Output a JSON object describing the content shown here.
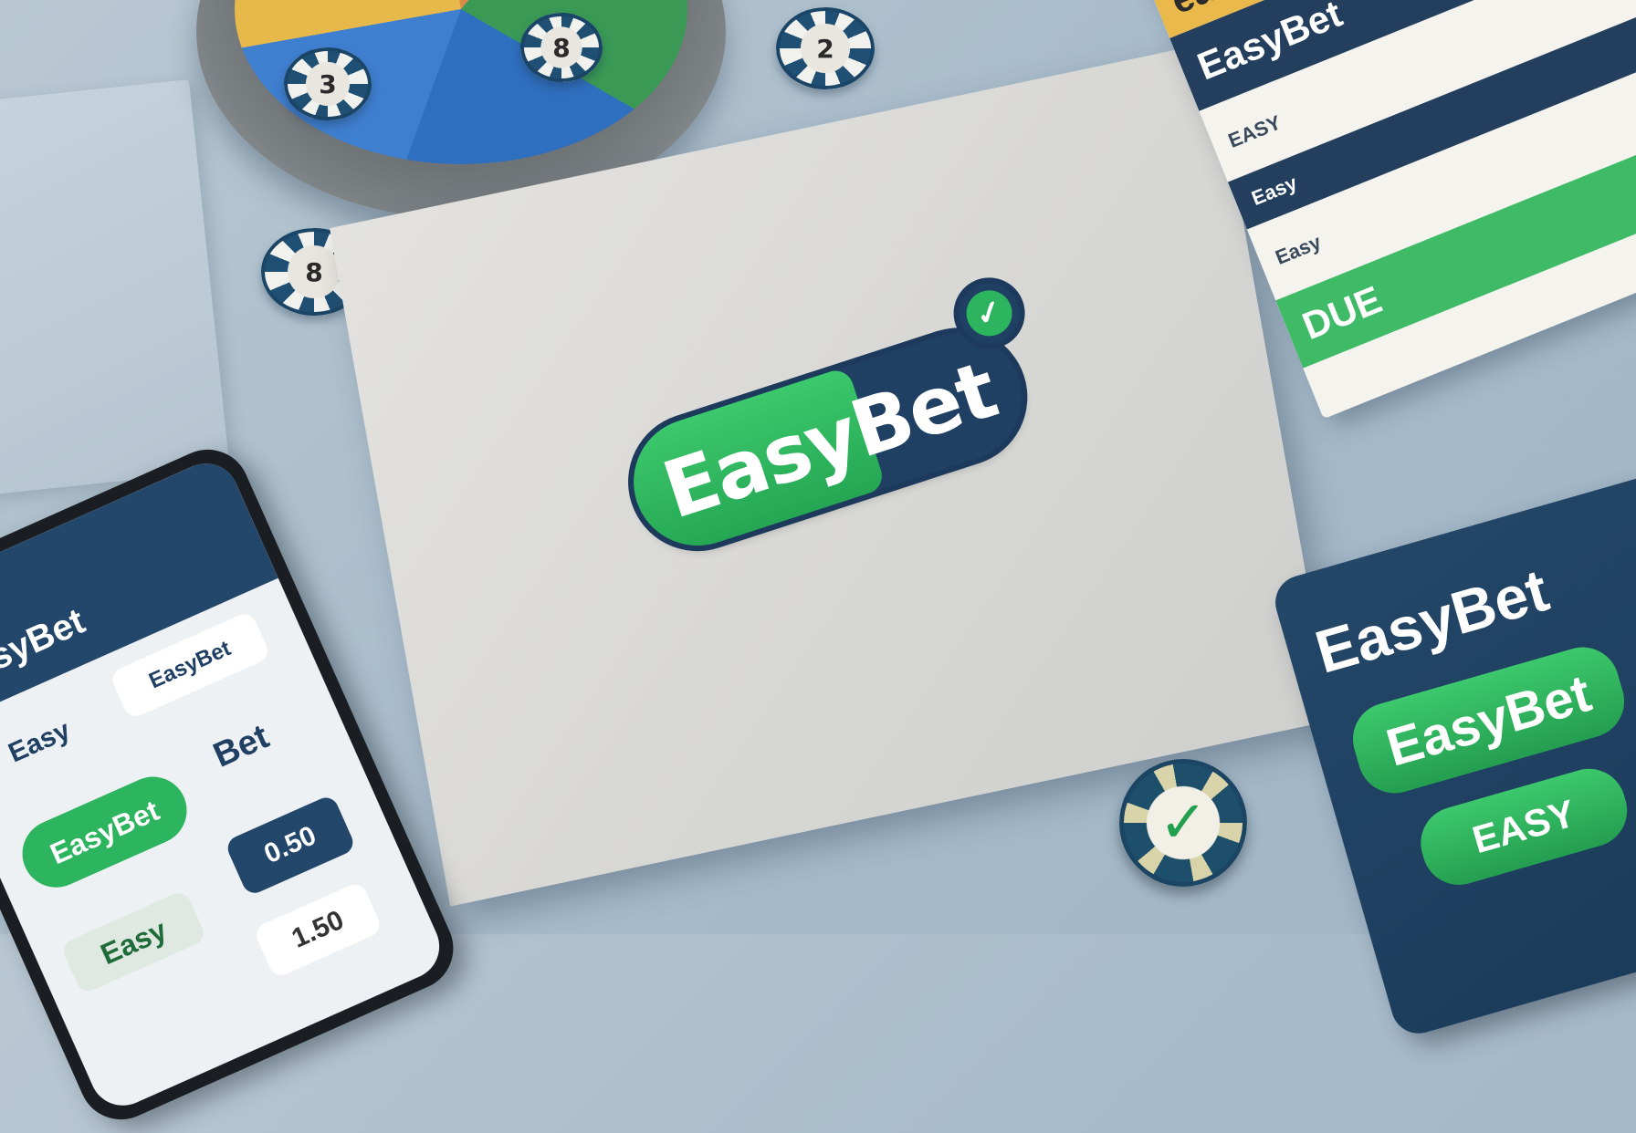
{
  "logo": {
    "text": "EasyBet",
    "accent_green": "#2db45f",
    "navy": "#1f3f63",
    "check_icon": "check-icon"
  },
  "chips": [
    {
      "label": "2"
    },
    {
      "label": "3"
    },
    {
      "label": "8"
    },
    {
      "label": "8"
    }
  ],
  "ticket": {
    "top_label": "easy",
    "header": "EasyBet",
    "rows": [
      "EASY",
      "Easy",
      "Easy",
      "DUE"
    ],
    "green_label": "DUE"
  },
  "phone": {
    "title": "EasyBet",
    "items": [
      "EasyBet",
      "Easy",
      "Bet",
      "EasyBet",
      "0.50",
      "Easy",
      "1.50"
    ]
  },
  "promo_card": {
    "line1": "EasyBet",
    "line2": "EasyBet",
    "line3": "EASY"
  }
}
